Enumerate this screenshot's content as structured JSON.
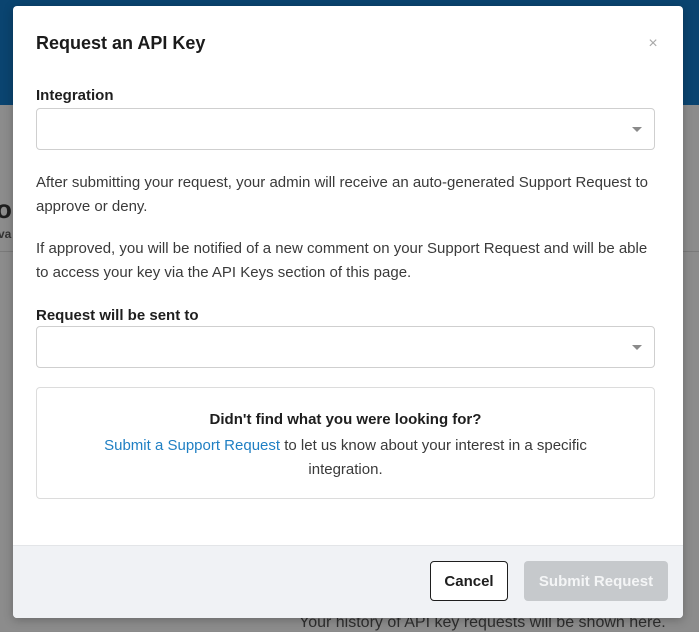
{
  "background": {
    "title_fragment": "or",
    "subtitle_fragment": "va",
    "history_text": "Your history of API key requests will be shown here."
  },
  "modal": {
    "title": "Request an API Key",
    "close_glyph": "×",
    "integration": {
      "label": "Integration",
      "value": ""
    },
    "paragraph1": "After submitting your request, your admin will receive an auto-generated Support Request to approve or deny.",
    "paragraph2": "If approved, you will be notified of a new comment on your Support Request and will be able to access your key via the API Keys section of this page.",
    "recipient": {
      "label": "Request will be sent to",
      "value": ""
    },
    "callout": {
      "heading": "Didn't find what you were looking for?",
      "link_text": "Submit a Support Request",
      "text_after_link": " to let us know about your interest in a specific integration."
    },
    "footer": {
      "cancel_label": "Cancel",
      "submit_label": "Submit Request",
      "submit_disabled": true
    }
  },
  "colors": {
    "header_blue": "#0a4470",
    "link_blue": "#1f7fc3",
    "disabled_button": "#c6c9cc"
  }
}
